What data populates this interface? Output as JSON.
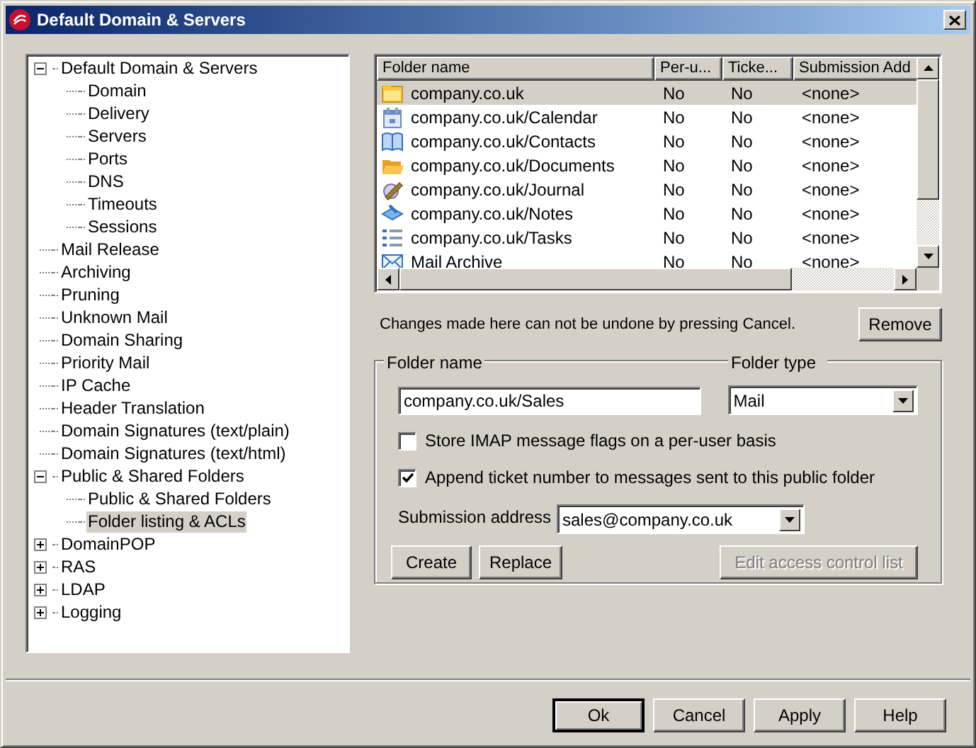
{
  "window": {
    "title": "Default Domain & Servers"
  },
  "tree": [
    {
      "label": "Default Domain & Servers",
      "expanded": true,
      "selected": false,
      "children": [
        {
          "label": "Domain",
          "selected": false
        },
        {
          "label": "Delivery",
          "selected": false
        },
        {
          "label": "Servers",
          "selected": false
        },
        {
          "label": "Ports",
          "selected": false
        },
        {
          "label": "DNS",
          "selected": false
        },
        {
          "label": "Timeouts",
          "selected": false
        },
        {
          "label": "Sessions",
          "selected": false
        }
      ]
    },
    {
      "label": "Mail Release",
      "selected": false
    },
    {
      "label": "Archiving",
      "selected": false
    },
    {
      "label": "Pruning",
      "selected": false
    },
    {
      "label": "Unknown Mail",
      "selected": false
    },
    {
      "label": "Domain Sharing",
      "selected": false
    },
    {
      "label": "Priority Mail",
      "selected": false
    },
    {
      "label": "IP Cache",
      "selected": false
    },
    {
      "label": "Header Translation",
      "selected": false
    },
    {
      "label": "Domain Signatures (text/plain)",
      "selected": false
    },
    {
      "label": "Domain Signatures (text/html)",
      "selected": false
    },
    {
      "label": "Public & Shared Folders",
      "expanded": true,
      "selected": false,
      "children": [
        {
          "label": "Public & Shared Folders",
          "selected": false
        },
        {
          "label": "Folder listing & ACLs",
          "selected": true
        }
      ]
    },
    {
      "label": "DomainPOP",
      "expanded": false,
      "selected": false
    },
    {
      "label": "RAS",
      "expanded": false,
      "selected": false
    },
    {
      "label": "LDAP",
      "expanded": false,
      "selected": false
    },
    {
      "label": "Logging",
      "expanded": false,
      "selected": false
    }
  ],
  "folders": {
    "columns": [
      "Folder name",
      "Per-u...",
      "Ticke...",
      "Submission Add"
    ],
    "rows": [
      {
        "kind": "folder",
        "cells": [
          "company.co.uk",
          "No",
          "No",
          "<none>"
        ],
        "selected": true
      },
      {
        "kind": "calendar",
        "cells": [
          "company.co.uk/Calendar",
          "No",
          "No",
          "<none>"
        ],
        "selected": false
      },
      {
        "kind": "contacts",
        "cells": [
          "company.co.uk/Contacts",
          "No",
          "No",
          "<none>"
        ],
        "selected": false
      },
      {
        "kind": "documents",
        "cells": [
          "company.co.uk/Documents",
          "No",
          "No",
          "<none>"
        ],
        "selected": false
      },
      {
        "kind": "journal",
        "cells": [
          "company.co.uk/Journal",
          "No",
          "No",
          "<none>"
        ],
        "selected": false
      },
      {
        "kind": "notes",
        "cells": [
          "company.co.uk/Notes",
          "No",
          "No",
          "<none>"
        ],
        "selected": false
      },
      {
        "kind": "tasks",
        "cells": [
          "company.co.uk/Tasks",
          "No",
          "No",
          "<none>"
        ],
        "selected": false
      },
      {
        "kind": "mail",
        "cells": [
          "Mail Archive",
          "No",
          "No",
          "<none>"
        ],
        "selected": false
      }
    ]
  },
  "note": "Changes made here can not be undone by pressing Cancel.",
  "remove_button": "Remove",
  "folder_form": {
    "name_label": "Folder name",
    "name_value": "company.co.uk/Sales",
    "type_label": "Folder type",
    "type_value": "Mail",
    "options": [
      {
        "label": "Store IMAP message flags on a per-user basis",
        "checked": false
      },
      {
        "label": "Append ticket number to messages sent to this public folder",
        "checked": true
      }
    ],
    "submission_label": "Submission address",
    "submission_value": "sales@company.co.uk",
    "buttons": [
      {
        "label": "Create",
        "disabled": false
      },
      {
        "label": "Replace",
        "disabled": false
      },
      {
        "label": "Edit access control list",
        "disabled": true
      }
    ]
  },
  "dialog_buttons": [
    {
      "label": "Ok",
      "default": true
    },
    {
      "label": "Cancel",
      "default": false
    },
    {
      "label": "Apply",
      "default": false
    },
    {
      "label": "Help",
      "default": false
    }
  ]
}
